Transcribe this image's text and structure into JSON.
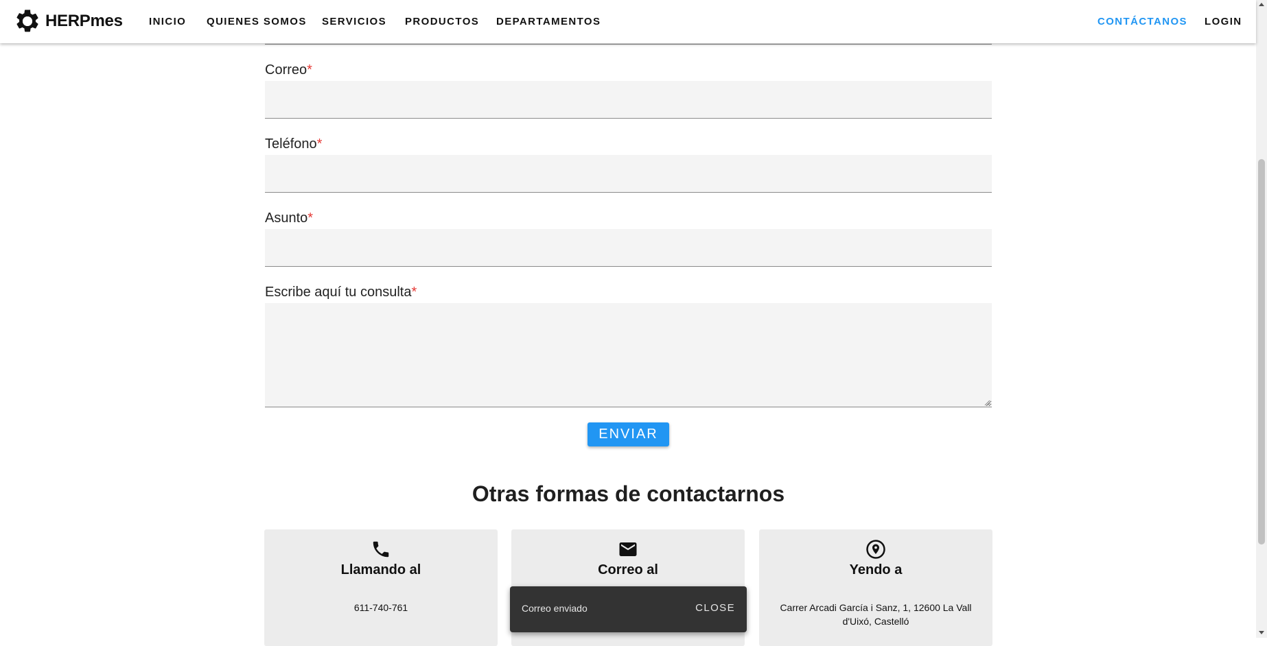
{
  "nav": {
    "brand": "HERPmes",
    "items": [
      "INICIO",
      "QUIENES SOMOS",
      "SERVICIOS",
      "PRODUCTOS",
      "DEPARTAMENTOS"
    ],
    "contact": "CONTÁCTANOS",
    "login": "LOGIN",
    "accent_color": "#2196f3"
  },
  "form": {
    "email_label": "Correo",
    "phone_label": "Teléfono",
    "subject_label": "Asunto",
    "message_label": "Escribe aquí tu consulta",
    "required_mark": "*",
    "submit": "ENVIAR"
  },
  "contact": {
    "title": "Otras formas de contactarnos",
    "cards": [
      {
        "icon": "phone-icon",
        "title": "Llamando al",
        "text": "611-740-761"
      },
      {
        "icon": "mail-icon",
        "title": "Correo al",
        "text": ""
      },
      {
        "icon": "location-icon",
        "title": "Yendo a",
        "text": "Carrer Arcadi García i Sanz, 1, 12600 La Vall d'Uixó, Castelló"
      }
    ]
  },
  "snackbar": {
    "message": "Correo enviado",
    "action": "CLOSE"
  }
}
